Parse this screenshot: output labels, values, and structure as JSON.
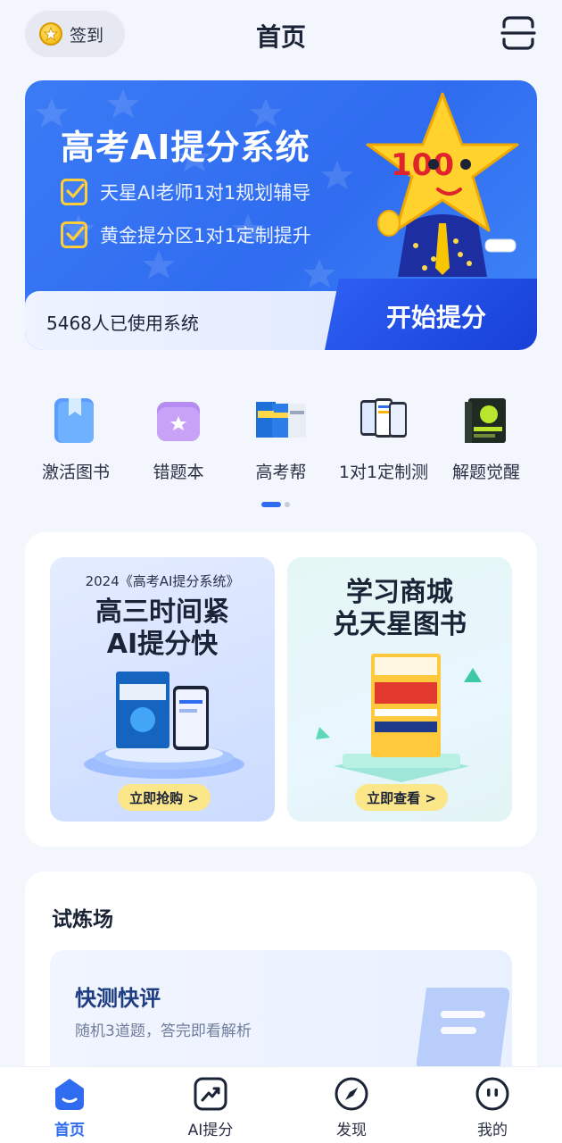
{
  "header": {
    "checkin_label": "签到",
    "title": "首页"
  },
  "hero": {
    "title": "高考AI提分系统",
    "features": [
      "天星AI老师1对1规划辅导",
      "黄金提分区1对1定制提升"
    ],
    "users_text": "5468人已使用系统",
    "start_label": "开始提分",
    "mascot_badge": "100"
  },
  "quick_entries": [
    {
      "label": "激活图书",
      "icon": "book-icon"
    },
    {
      "label": "错题本",
      "icon": "folder-icon"
    },
    {
      "label": "高考帮",
      "icon": "books-cover-icon"
    },
    {
      "label": "1对1定制测",
      "icon": "phones-icon"
    },
    {
      "label": "解题觉醒",
      "icon": "book-cover-icon"
    }
  ],
  "promos": {
    "left": {
      "subtitle": "2024《高考AI提分系统》",
      "heading_1": "高三时间紧",
      "heading_2": "AI提分快",
      "button": "立即抢购 >"
    },
    "right": {
      "heading_1": "学习商城",
      "heading_2": "兑天星图书",
      "button": "立即查看 >"
    }
  },
  "practice": {
    "title": "试炼场",
    "card_title": "快测快评",
    "card_desc": "随机3道题，答完即看解析"
  },
  "tabs": [
    {
      "label": "首页",
      "active": true
    },
    {
      "label": "AI提分",
      "active": false
    },
    {
      "label": "发现",
      "active": false
    },
    {
      "label": "我的",
      "active": false
    }
  ],
  "colors": {
    "primary": "#2f6cf0",
    "accent_yellow": "#ffcf3a",
    "background": "#f3f6fd"
  }
}
